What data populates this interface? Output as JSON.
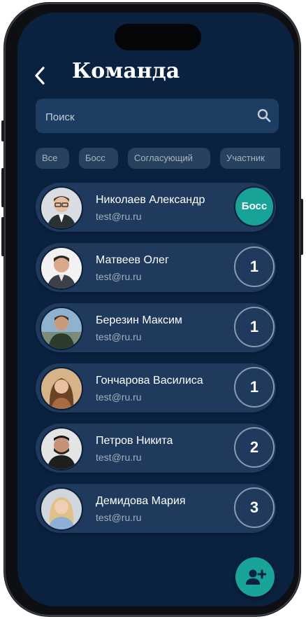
{
  "header": {
    "back_icon": "chevron-left-icon",
    "title": "Команда"
  },
  "search": {
    "placeholder": "Поиск",
    "icon": "search-icon"
  },
  "filters": [
    {
      "label": "Все"
    },
    {
      "label": "Босс"
    },
    {
      "label": "Согласующий"
    },
    {
      "label": "Участник"
    }
  ],
  "members": [
    {
      "name": "Николаев Александр",
      "email": "test@ru.ru",
      "badge": "Босс",
      "is_boss": true
    },
    {
      "name": "Матвеев Олег",
      "email": "test@ru.ru",
      "badge": "1",
      "is_boss": false
    },
    {
      "name": "Березин Максим",
      "email": "test@ru.ru",
      "badge": "1",
      "is_boss": false
    },
    {
      "name": "Гончарова Василиса",
      "email": "test@ru.ru",
      "badge": "1",
      "is_boss": false
    },
    {
      "name": "Петров Никита",
      "email": "test@ru.ru",
      "badge": "2",
      "is_boss": false
    },
    {
      "name": "Демидова Мария",
      "email": "test@ru.ru",
      "badge": "3",
      "is_boss": false
    }
  ],
  "fab": {
    "icon": "add-user-icon"
  },
  "colors": {
    "background": "#0a2140",
    "card": "#1f3a5c",
    "accent": "#17a397",
    "text_secondary": "#a4b0bf"
  }
}
